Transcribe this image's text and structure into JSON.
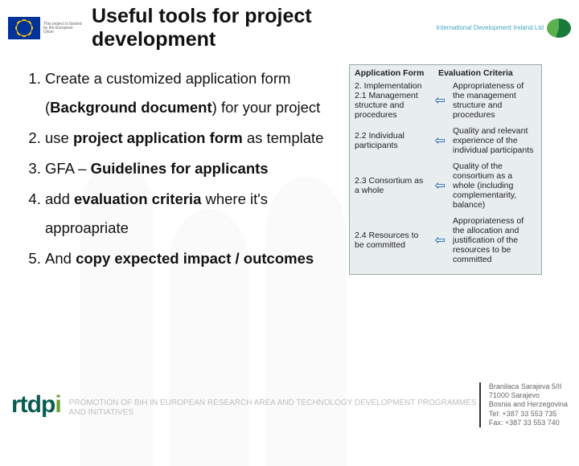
{
  "header": {
    "eu_caption": "This project is funded by the European Union",
    "title": "Useful tools for project development",
    "idi_text": "International Development Ireland Ltd"
  },
  "list": {
    "i1_a": "Create a  customized application form (",
    "i1_b": "Background document",
    "i1_c": ") for your project",
    "i2_a": " use ",
    "i2_b": "project application form",
    "i2_c": " as template",
    "i3_a": " GFA – ",
    "i3_b": "Guidelines for applicants",
    "i4_a": " add ",
    "i4_b": "evaluation criteria",
    "i4_c": " where it's approapriate",
    "i5_a": "And ",
    "i5_b": "copy expected impact / outcomes"
  },
  "diagram": {
    "head_left": "Application Form",
    "head_right": "Evaluation Criteria",
    "rows": [
      {
        "left": "2. Implementation\n2.1 Management structure and procedures",
        "right": "Appropriateness of the management structure and procedures"
      },
      {
        "left": "2.2 Individual participants",
        "right": "Quality and relevant experience of the individual participants"
      },
      {
        "left": "2.3 Consortium as a whole",
        "right": "Quality of the consortium as a whole (including complementarity, balance)"
      },
      {
        "left": "2.4 Resources to be committed",
        "right": "Appropriateness of the allocation and justification of the resources to be committed"
      }
    ]
  },
  "footer": {
    "logo": "rtdp",
    "logo_dot": "i",
    "mid": "PROMOTION OF BIH IN EUROPEAN RESEARCH AREA AND TECHNOLOGY DEVELOPMENT PROGRAMMES AND INITIATIVES",
    "right": "Branilaca Sarajeva 5/II\n71000 Sarajevo\nBosnia and Herzegovina\nTel: +387 33 553 735\nFax: +387 33 553 740"
  }
}
